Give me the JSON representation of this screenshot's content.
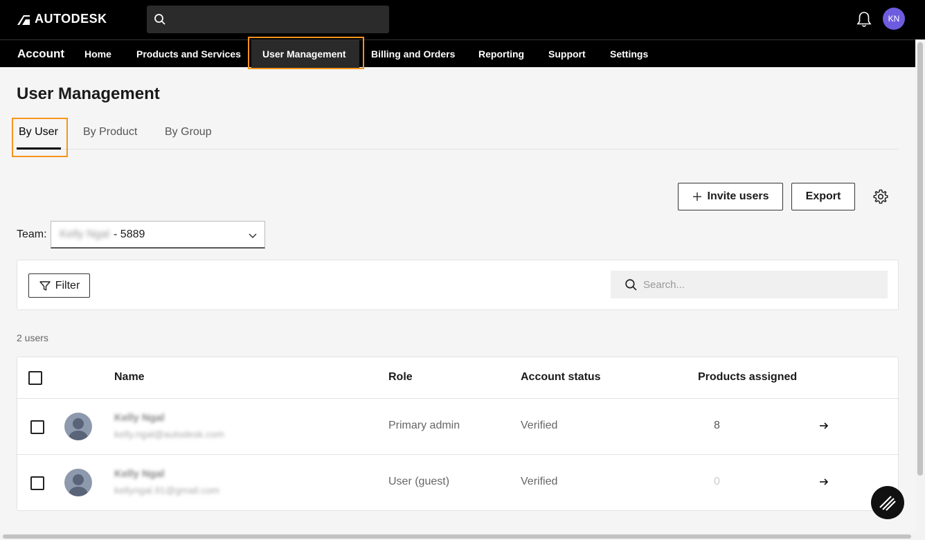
{
  "header": {
    "logo_text": "AUTODESK",
    "avatar_initials": "KN",
    "avatar_color": "#6e5ce0",
    "search_placeholder": ""
  },
  "nav": {
    "title": "Account",
    "items": [
      {
        "label": "Home"
      },
      {
        "label": "Products and Services"
      },
      {
        "label": "User Management"
      },
      {
        "label": "Billing and Orders"
      },
      {
        "label": "Reporting"
      },
      {
        "label": "Support"
      },
      {
        "label": "Settings"
      }
    ],
    "active": "User Management"
  },
  "page": {
    "title": "User Management",
    "tabs": [
      {
        "label": "By User"
      },
      {
        "label": "By Product"
      },
      {
        "label": "By Group"
      }
    ],
    "active_tab": "By User"
  },
  "actions": {
    "invite_label": "Invite users",
    "export_label": "Export"
  },
  "team": {
    "label": "Team:",
    "owner_name": "Kelly Ngal",
    "id_suffix": "- 5889"
  },
  "filter": {
    "label": "Filter",
    "search_placeholder": "Search..."
  },
  "user_count": "2 users",
  "table": {
    "columns": [
      "Name",
      "Role",
      "Account status",
      "Products assigned"
    ],
    "rows": [
      {
        "name": "Kelly Ngal",
        "email": "kelly.ngal@autodesk.com",
        "role": "Primary admin",
        "status": "Verified",
        "products": "8"
      },
      {
        "name": "Kelly Ngal",
        "email": "kellyngal.91@gmail.com",
        "role": "User (guest)",
        "status": "Verified",
        "products": "0"
      }
    ]
  },
  "colors": {
    "highlight": "#f7941d",
    "topbar": "#000000"
  }
}
